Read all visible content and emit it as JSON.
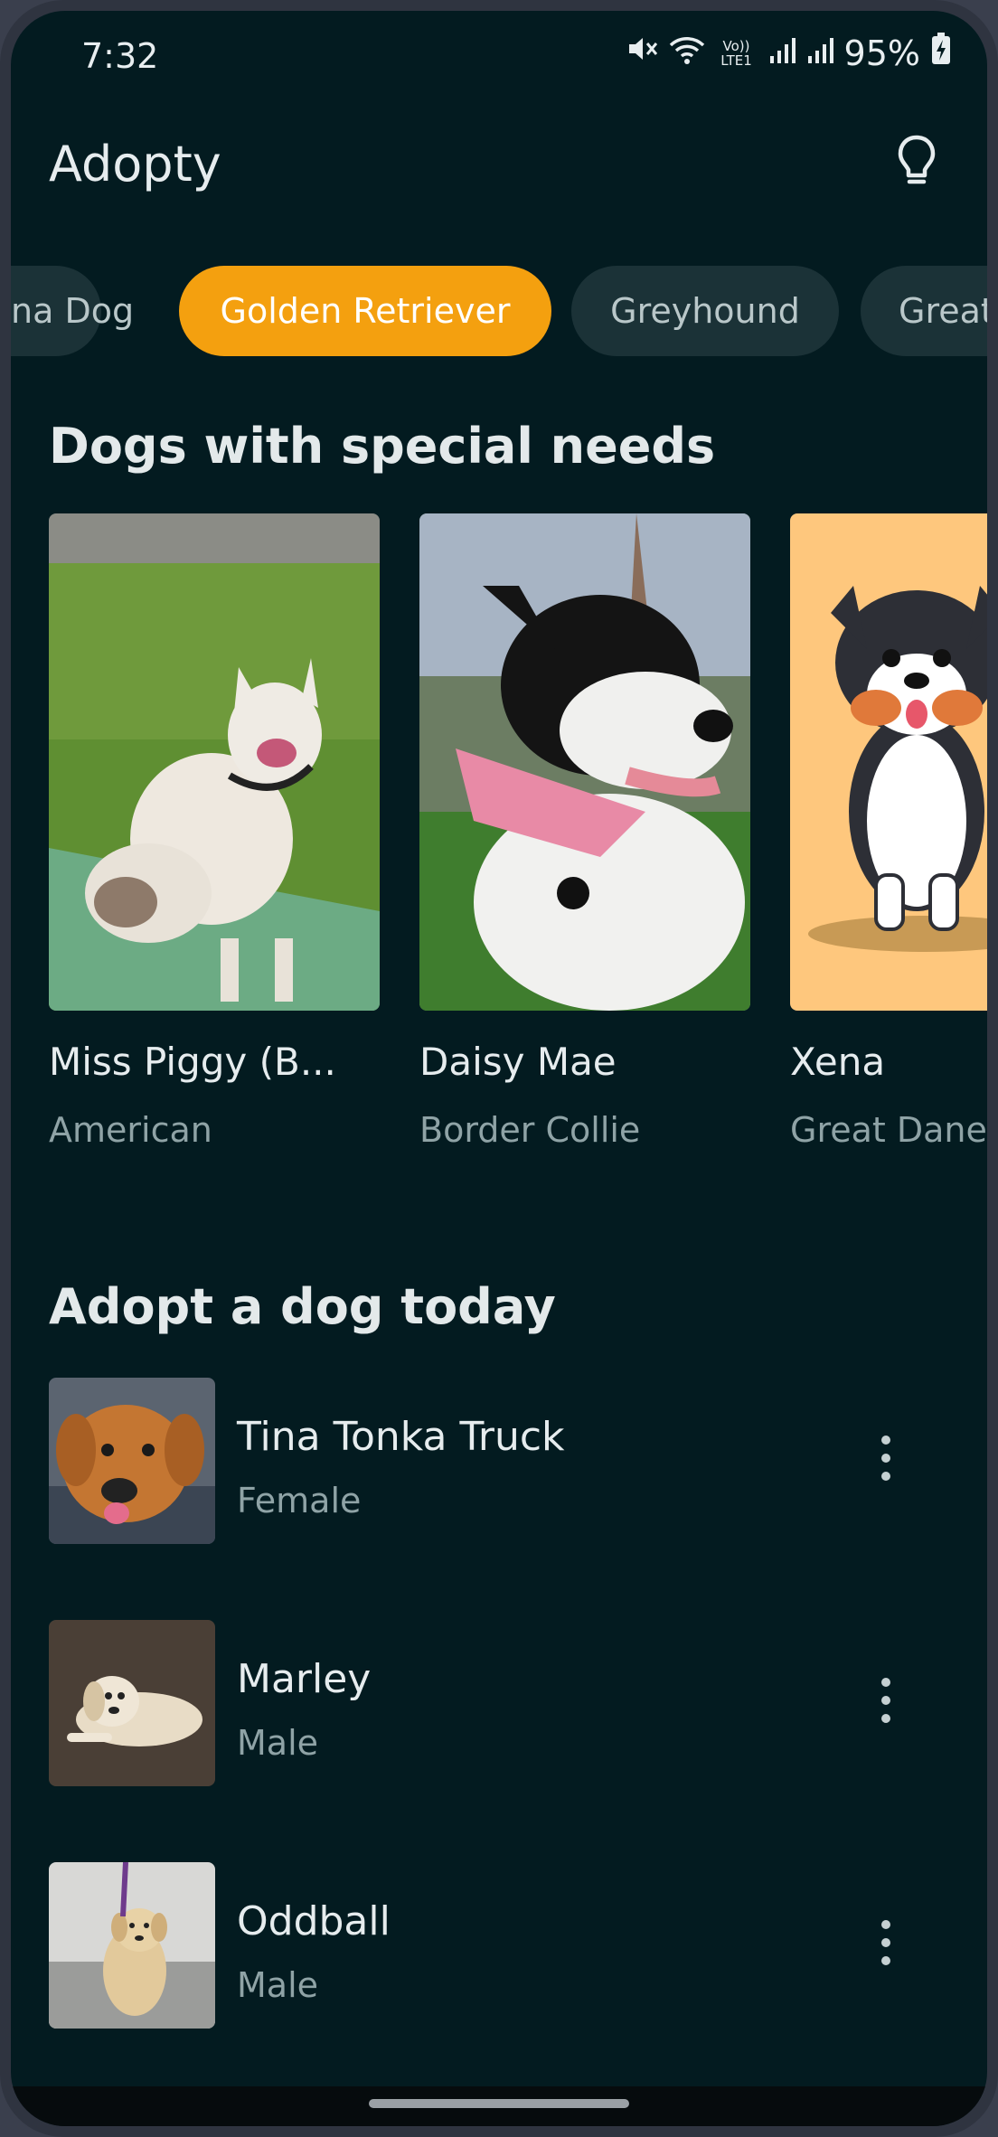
{
  "status_bar": {
    "time": "7:32",
    "battery_percent": "95%",
    "network_label": "Vo)) LTE1"
  },
  "app": {
    "title": "Adopty"
  },
  "breed_chips": [
    {
      "label": "na Dog",
      "selected": false
    },
    {
      "label": "Golden Retriever",
      "selected": true
    },
    {
      "label": "Greyhound",
      "selected": false
    },
    {
      "label": "Great",
      "selected": false
    }
  ],
  "special_needs": {
    "title": "Dogs with special needs",
    "dogs": [
      {
        "name": "Miss Piggy (B...",
        "breed": "American"
      },
      {
        "name": "Daisy Mae",
        "breed": "Border Collie"
      },
      {
        "name": "Xena",
        "breed": "Great Dane"
      }
    ]
  },
  "adopt_today": {
    "title": "Adopt a dog today",
    "dogs": [
      {
        "name": "Tina Tonka Truck",
        "sex": "Female"
      },
      {
        "name": "Marley",
        "sex": "Male"
      },
      {
        "name": "Oddball",
        "sex": "Male"
      }
    ]
  },
  "colors": {
    "background": "#031b20",
    "chip_bg": "#1b3237",
    "chip_selected": "#f4a00f",
    "text_primary": "#e6ecee",
    "text_secondary": "#8fa3a6"
  }
}
